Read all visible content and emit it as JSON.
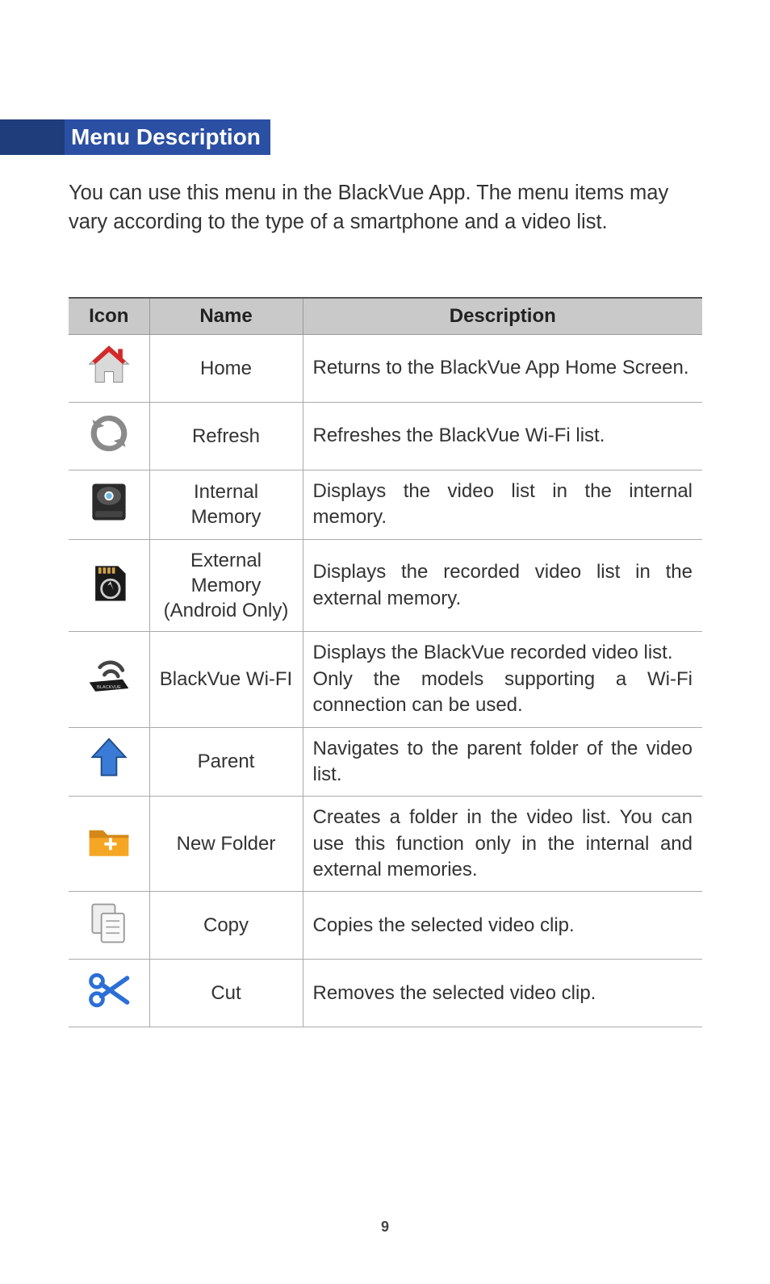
{
  "heading": "Menu Description",
  "intro": "You can use this menu in the BlackVue App. The menu items may vary according to the type of a smartphone and a video list.",
  "table": {
    "headers": {
      "icon": "Icon",
      "name": "Name",
      "description": "Description"
    },
    "rows": [
      {
        "icon": "home-icon",
        "name": "Home",
        "description": "Returns to the BlackVue App Home Screen."
      },
      {
        "icon": "refresh-icon",
        "name": "Refresh",
        "description": "Refreshes the BlackVue Wi-Fi list."
      },
      {
        "icon": "internal-memory-icon",
        "name": "Internal Memory",
        "description": "Displays the video list in the internal memory."
      },
      {
        "icon": "external-memory-icon",
        "name": "External Memory (Android Only)",
        "description": "Displays the recorded video list in the external memory."
      },
      {
        "icon": "blackvue-wifi-icon",
        "name": "BlackVue Wi-FI",
        "description": "Displays the BlackVue recorded video list.\nOnly the models supporting a Wi-Fi connection can be used."
      },
      {
        "icon": "parent-arrow-icon",
        "name": "Parent",
        "description": "Navigates to the parent folder of the video list."
      },
      {
        "icon": "new-folder-icon",
        "name": "New Folder",
        "description": "Creates a folder in the video list. You can use this function only in the internal and external memories."
      },
      {
        "icon": "copy-icon",
        "name": "Copy",
        "description": "Copies the selected video clip."
      },
      {
        "icon": "cut-icon",
        "name": "Cut",
        "description": "Removes the selected video clip."
      }
    ]
  },
  "page_number": "9"
}
